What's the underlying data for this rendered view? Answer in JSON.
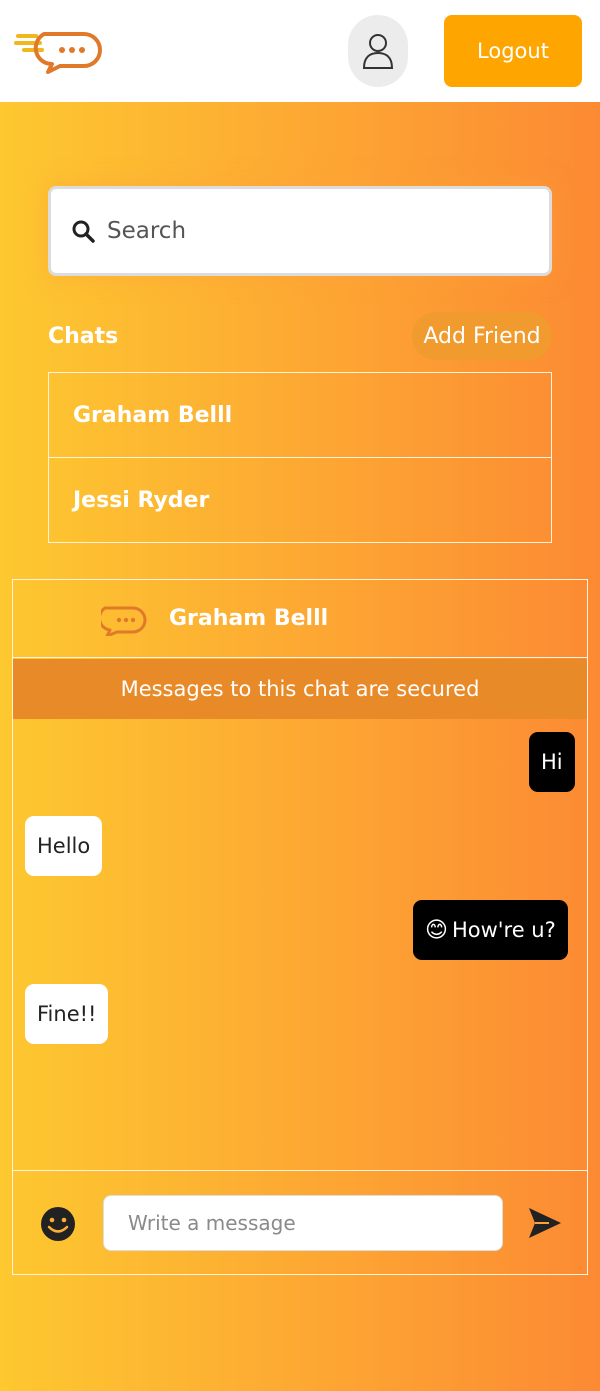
{
  "colors": {
    "accent": "#ffa500",
    "brand_orange": "#e07a2a",
    "gradient_start": "#fdc830",
    "gradient_end": "#fc8a33",
    "banner": "#e88a28",
    "outgoing_bubble": "#000000",
    "incoming_bubble": "#ffffff"
  },
  "header": {
    "logo_icon": "chat-bubble-logo-icon",
    "profile_icon": "user-icon",
    "logout_label": "Logout"
  },
  "search": {
    "icon": "search-icon",
    "placeholder": "Search"
  },
  "chats": {
    "title": "Chats",
    "add_friend_label": "Add Friend",
    "items": [
      {
        "name": "Graham Belll"
      },
      {
        "name": "Jessi Ryder"
      }
    ]
  },
  "chat_window": {
    "contact_name": "Graham Belll",
    "secure_notice": "Messages to this chat are secured",
    "messages": [
      {
        "direction": "outgoing",
        "text": "Hi"
      },
      {
        "direction": "incoming",
        "text": "Hello"
      },
      {
        "direction": "outgoing",
        "emoji": "😊",
        "text": "How're u?"
      },
      {
        "direction": "incoming",
        "text": "Fine!!"
      }
    ],
    "composer": {
      "emoji_icon": "smiley-icon",
      "placeholder": "Write a message",
      "send_icon": "send-icon"
    }
  }
}
